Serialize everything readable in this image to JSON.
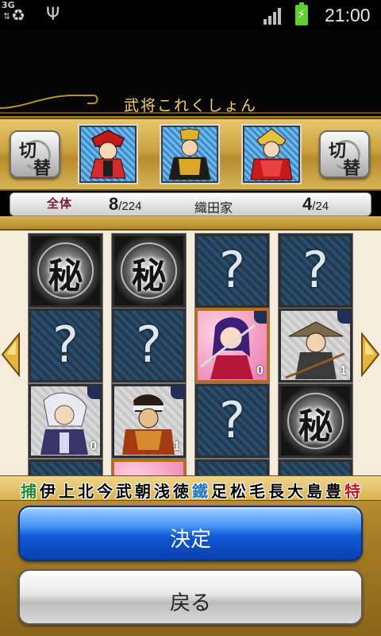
{
  "statusbar": {
    "icons": [
      "recycle-icon",
      "usb-icon",
      "3g-data-icon",
      "signal-strength-icon",
      "battery-charging-icon"
    ],
    "network_label": "3G",
    "time": "21:00"
  },
  "header": {
    "title": "武将これくしょん"
  },
  "switch": {
    "glyph_top": "切",
    "glyph_bottom": "替"
  },
  "featured_generals": [
    "general-red-helmet",
    "general-gold-armor",
    "general-red-samurai"
  ],
  "counters": {
    "overall_label": "全体",
    "overall_owned": "8",
    "overall_total": "/224",
    "clan_name": "織田家",
    "clan_owned": "4",
    "clan_total": "/24"
  },
  "grid": {
    "secret_glyph": "秘",
    "unknown_glyph": "?",
    "cells": [
      {
        "kind": "secret"
      },
      {
        "kind": "secret"
      },
      {
        "kind": "unknown"
      },
      {
        "kind": "unknown"
      },
      {
        "kind": "unknown"
      },
      {
        "kind": "unknown"
      },
      {
        "kind": "general",
        "portrait": "purple-hair-swordswoman",
        "count": "0"
      },
      {
        "kind": "general",
        "portrait": "straw-hat-monk",
        "count": "1"
      },
      {
        "kind": "general",
        "portrait": "white-hair-warrior",
        "count": "0"
      },
      {
        "kind": "general",
        "portrait": "headband-warrior",
        "count": "1"
      },
      {
        "kind": "unknown"
      },
      {
        "kind": "secret"
      }
    ]
  },
  "clan_filters": [
    "捕",
    "伊",
    "上",
    "北",
    "今",
    "武",
    "朝",
    "浅",
    "徳",
    "鐵",
    "足",
    "松",
    "毛",
    "長",
    "大",
    "島",
    "豊",
    "特"
  ],
  "buttons": {
    "decide": "決定",
    "back": "戻る"
  },
  "colors": {
    "header_title": "#f3d35a",
    "gold": "#c39a3c",
    "decide_blue": "#1259d6",
    "clan_green": "#1f8d2e",
    "clan_blue": "#2577c6",
    "clan_red": "#c4161c"
  }
}
